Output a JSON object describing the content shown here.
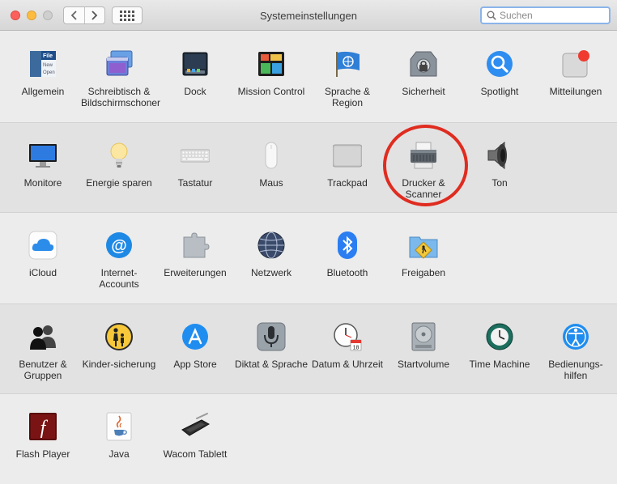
{
  "window": {
    "title": "Systemeinstellungen",
    "search_placeholder": "Suchen"
  },
  "rows": [
    {
      "panes": [
        {
          "label": "Allgemein",
          "icon": "general-icon",
          "icon_text": "File\nNew\nOpen"
        },
        {
          "label": "Schreibtisch & Bildschirmschoner",
          "icon": "desktop-screensaver-icon"
        },
        {
          "label": "Dock",
          "icon": "dock-icon"
        },
        {
          "label": "Mission Control",
          "icon": "mission-control-icon"
        },
        {
          "label": "Sprache & Region",
          "icon": "language-region-icon"
        },
        {
          "label": "Sicherheit",
          "icon": "security-icon"
        },
        {
          "label": "Spotlight",
          "icon": "spotlight-icon"
        },
        {
          "label": "Mitteilungen",
          "icon": "notifications-icon"
        }
      ]
    },
    {
      "panes": [
        {
          "label": "Monitore",
          "icon": "displays-icon"
        },
        {
          "label": "Energie sparen",
          "icon": "energy-saver-icon"
        },
        {
          "label": "Tastatur",
          "icon": "keyboard-icon"
        },
        {
          "label": "Maus",
          "icon": "mouse-icon"
        },
        {
          "label": "Trackpad",
          "icon": "trackpad-icon"
        },
        {
          "label": "Drucker & Scanner",
          "icon": "printer-scanner-icon"
        },
        {
          "label": "Ton",
          "icon": "sound-icon"
        }
      ]
    },
    {
      "panes": [
        {
          "label": "iCloud",
          "icon": "icloud-icon"
        },
        {
          "label": "Internet-Accounts",
          "icon": "internet-accounts-icon",
          "icon_text": "@"
        },
        {
          "label": "Erweiterungen",
          "icon": "extensions-icon"
        },
        {
          "label": "Netzwerk",
          "icon": "network-icon"
        },
        {
          "label": "Bluetooth",
          "icon": "bluetooth-icon",
          "icon_text": "ᛒ"
        },
        {
          "label": "Freigaben",
          "icon": "sharing-icon"
        }
      ]
    },
    {
      "panes": [
        {
          "label": "Benutzer & Gruppen",
          "icon": "users-groups-icon"
        },
        {
          "label": "Kinder-sicherung",
          "icon": "parental-controls-icon"
        },
        {
          "label": "App Store",
          "icon": "app-store-icon"
        },
        {
          "label": "Diktat & Sprache",
          "icon": "dictation-speech-icon"
        },
        {
          "label": "Datum & Uhrzeit",
          "icon": "date-time-icon",
          "icon_text": "18"
        },
        {
          "label": "Startvolume",
          "icon": "startup-disk-icon"
        },
        {
          "label": "Time Machine",
          "icon": "time-machine-icon"
        },
        {
          "label": "Bedienungs-hilfen",
          "icon": "accessibility-icon"
        }
      ]
    },
    {
      "panes": [
        {
          "label": "Flash Player",
          "icon": "flash-player-icon",
          "icon_text": "f"
        },
        {
          "label": "Java",
          "icon": "java-icon"
        },
        {
          "label": "Wacom Tablett",
          "icon": "wacom-tablet-icon"
        }
      ]
    }
  ]
}
